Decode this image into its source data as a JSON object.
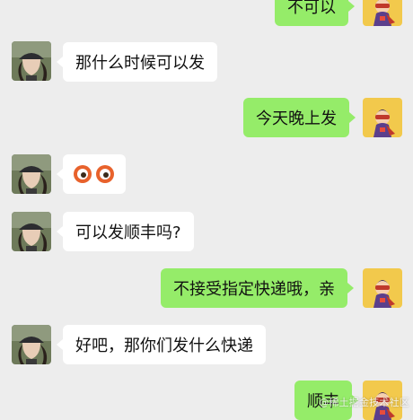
{
  "messages": [
    {
      "side": "out",
      "text": "不可以"
    },
    {
      "side": "in",
      "text": "那什么时候可以发"
    },
    {
      "side": "out",
      "text": "今天晚上发"
    },
    {
      "side": "in",
      "emoji": "eyes-emoji"
    },
    {
      "side": "in",
      "text": "可以发顺丰吗?"
    },
    {
      "side": "out",
      "text": "不接受指定快递哦，亲"
    },
    {
      "side": "in",
      "text": "好吧，那你们发什么快递"
    },
    {
      "side": "out",
      "text": "顺丰"
    }
  ],
  "watermark": "@稀土掘金技术社区",
  "colors": {
    "chat_background": "#ededed",
    "incoming_bubble": "#ffffff",
    "outgoing_bubble": "#95ec69"
  },
  "avatars": {
    "incoming": "user-photo-avatar",
    "outgoing": "cartoon-hero-avatar"
  }
}
